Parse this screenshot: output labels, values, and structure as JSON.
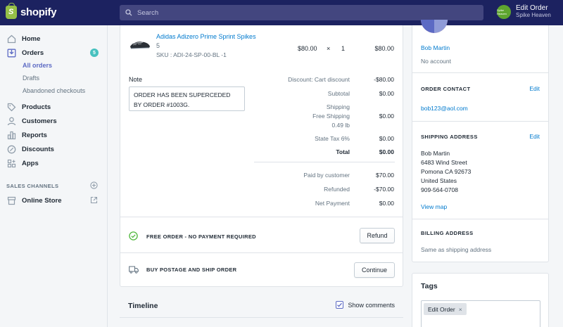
{
  "brand": {
    "name": "shopify",
    "accent": "#95bf47",
    "nav_bg": "#1c2260"
  },
  "search": {
    "placeholder": "Search"
  },
  "store": {
    "avatar_text": "Spike Heaven",
    "title": "Edit Order",
    "subtitle": "Spike Heaven"
  },
  "sidebar": {
    "items": [
      {
        "label": "Home",
        "icon": "home-icon"
      },
      {
        "label": "Orders",
        "icon": "orders-icon",
        "badge": "5"
      },
      {
        "label": "Products",
        "icon": "tag-icon"
      },
      {
        "label": "Customers",
        "icon": "person-icon"
      },
      {
        "label": "Reports",
        "icon": "bar-chart-icon"
      },
      {
        "label": "Discounts",
        "icon": "discount-icon"
      },
      {
        "label": "Apps",
        "icon": "apps-icon"
      }
    ],
    "sub_items": [
      {
        "label": "All orders",
        "active": true
      },
      {
        "label": "Drafts"
      },
      {
        "label": "Abandoned checkouts"
      }
    ],
    "sales_channels_title": "SALES CHANNELS",
    "online_store": "Online Store"
  },
  "order": {
    "line_item": {
      "name": "Adidas Adizero Prime Sprint Spikes",
      "variant": "5",
      "sku": "SKU : ADI-24-SP-00-BL -1",
      "price": "$80.00",
      "times": "×",
      "qty": "1",
      "total": "$80.00"
    },
    "note_label": "Note",
    "note_text": "ORDER HAS BEEN SUPERCEDED BY ORDER #1003G.",
    "summary": [
      {
        "label": "Discount: Cart discount",
        "value": "-$80.00"
      },
      {
        "label": "Subtotal",
        "value": "$0.00"
      },
      {
        "label": "Shipping",
        "label2": "Free Shipping",
        "label3": "0.49 lb",
        "value": "$0.00"
      },
      {
        "label": "State Tax 6%",
        "value": "$0.00"
      },
      {
        "label": "Total",
        "value": "$0.00"
      }
    ],
    "payments": [
      {
        "label": "Paid by customer",
        "value": "$70.00"
      },
      {
        "label": "Refunded",
        "value": "-$70.00"
      },
      {
        "label": "Net Payment",
        "value": "$0.00"
      }
    ],
    "free_order_text": "FREE ORDER - NO PAYMENT REQUIRED",
    "refund_label": "Refund",
    "postage_text": "BUY POSTAGE AND SHIP ORDER",
    "continue_label": "Continue"
  },
  "timeline": {
    "title": "Timeline",
    "show_comments": "Show comments",
    "show_comments_checked": true
  },
  "customer": {
    "name": "Bob Martin",
    "account": "No account",
    "contact_title": "ORDER CONTACT",
    "edit_label": "Edit",
    "email": "bob123@aol.com",
    "shipping_title": "SHIPPING ADDRESS",
    "address": [
      "Bob Martin",
      "6483 Wind Street",
      "Pomona CA 92673",
      "United States",
      "909-564-0708"
    ],
    "view_map": "View map",
    "billing_title": "BILLING ADDRESS",
    "billing_text": "Same as shipping address"
  },
  "tags": {
    "title": "Tags",
    "items": [
      "Edit Order"
    ],
    "remove_symbol": "×"
  }
}
